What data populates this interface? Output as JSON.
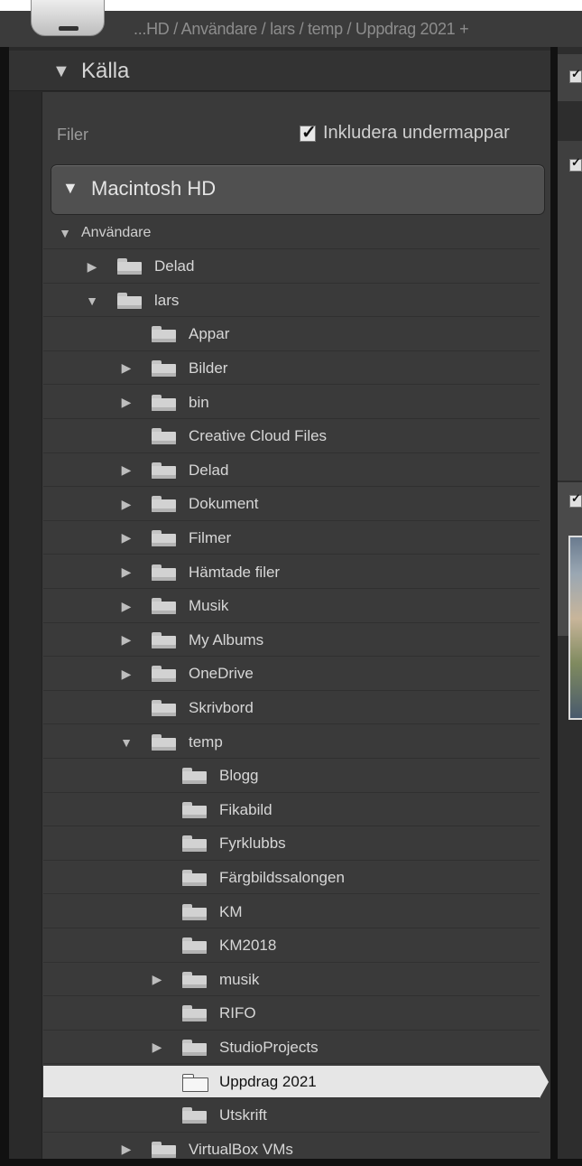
{
  "header": {
    "breadcrumb": "...HD / Användare / lars / temp / Uppdrag 2021 +"
  },
  "panel": {
    "title": "Källa",
    "files_label": "Filer",
    "include_subfolders": {
      "label": "Inkludera undermappar",
      "checked": true
    },
    "volume": "Macintosh HD"
  },
  "tree": [
    {
      "label": "Användare",
      "depth": 0,
      "expander": "open",
      "header": true
    },
    {
      "label": "Delad",
      "depth": 1,
      "expander": "closed"
    },
    {
      "label": "lars",
      "depth": 1,
      "expander": "open"
    },
    {
      "label": "Appar",
      "depth": 2,
      "expander": "none"
    },
    {
      "label": "Bilder",
      "depth": 2,
      "expander": "closed"
    },
    {
      "label": "bin",
      "depth": 2,
      "expander": "closed"
    },
    {
      "label": "Creative Cloud Files",
      "depth": 2,
      "expander": "none"
    },
    {
      "label": "Delad",
      "depth": 2,
      "expander": "closed"
    },
    {
      "label": "Dokument",
      "depth": 2,
      "expander": "closed"
    },
    {
      "label": "Filmer",
      "depth": 2,
      "expander": "closed"
    },
    {
      "label": "Hämtade filer",
      "depth": 2,
      "expander": "closed"
    },
    {
      "label": "Musik",
      "depth": 2,
      "expander": "closed"
    },
    {
      "label": "My Albums",
      "depth": 2,
      "expander": "closed"
    },
    {
      "label": "OneDrive",
      "depth": 2,
      "expander": "closed"
    },
    {
      "label": "Skrivbord",
      "depth": 2,
      "expander": "none"
    },
    {
      "label": "temp",
      "depth": 2,
      "expander": "open"
    },
    {
      "label": "Blogg",
      "depth": 3,
      "expander": "none"
    },
    {
      "label": "Fikabild",
      "depth": 3,
      "expander": "none"
    },
    {
      "label": "Fyrklubbs",
      "depth": 3,
      "expander": "none"
    },
    {
      "label": "Färgbildssalongen",
      "depth": 3,
      "expander": "none"
    },
    {
      "label": "KM",
      "depth": 3,
      "expander": "none"
    },
    {
      "label": "KM2018",
      "depth": 3,
      "expander": "none"
    },
    {
      "label": "musik",
      "depth": 3,
      "expander": "closed"
    },
    {
      "label": "RIFO",
      "depth": 3,
      "expander": "none"
    },
    {
      "label": "StudioProjects",
      "depth": 3,
      "expander": "closed"
    },
    {
      "label": "Uppdrag 2021",
      "depth": 3,
      "expander": "none",
      "selected": true
    },
    {
      "label": "Utskrift",
      "depth": 3,
      "expander": "none"
    },
    {
      "label": "VirtualBox VMs",
      "depth": 2,
      "expander": "closed"
    }
  ],
  "colors": {
    "panel_bg": "#3a3a3a",
    "selected_bg": "#e6e6e6",
    "text": "#d7d7d7"
  },
  "icons": {
    "open": "triangle-down-icon",
    "closed": "triangle-right-icon",
    "folder": "folder-icon",
    "check": "checkbox-icon"
  }
}
